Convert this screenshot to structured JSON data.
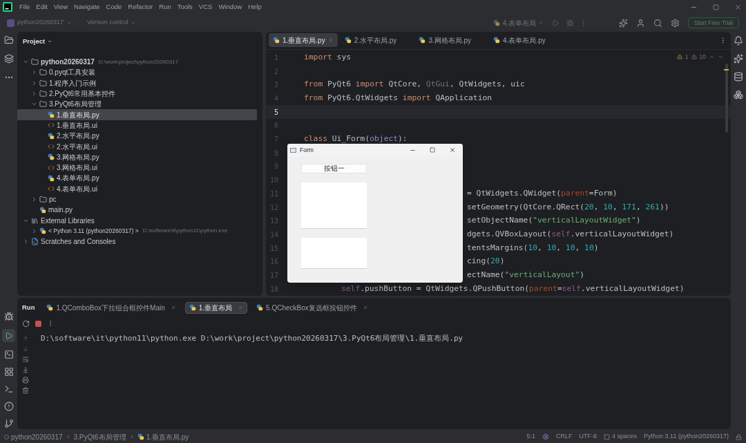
{
  "menu": [
    "File",
    "Edit",
    "View",
    "Navigate",
    "Code",
    "Refactor",
    "Run",
    "Tools",
    "VCS",
    "Window",
    "Help"
  ],
  "toolbar": {
    "project": "python20260317",
    "vcs": "Version control",
    "run_config": "4.表单布局",
    "trial_button": "Start Free Trial"
  },
  "project": {
    "title": "Project",
    "tree": [
      {
        "label": "python20260317",
        "kind": "folder",
        "expanded": true,
        "selected": false,
        "hint": "D:\\work\\project\\python20260317",
        "children": [
          {
            "label": "0.pyqt工具安装",
            "kind": "folder",
            "expanded": false,
            "selected": false
          },
          {
            "label": "1.程序入门示例",
            "kind": "folder",
            "expanded": false,
            "selected": false
          },
          {
            "label": "2.PyQt6常用基本控件",
            "kind": "folder",
            "expanded": false,
            "selected": false
          },
          {
            "label": "3.PyQt6布局管理",
            "kind": "folder",
            "expanded": true,
            "selected": false,
            "children": [
              {
                "label": "1.垂直布局.py",
                "kind": "py",
                "selected": true
              },
              {
                "label": "1.垂直布局.ui",
                "kind": "ui",
                "selected": false
              },
              {
                "label": "2.水平布局.py",
                "kind": "py",
                "selected": false
              },
              {
                "label": "2.水平布局.ui",
                "kind": "ui",
                "selected": false
              },
              {
                "label": "3.网格布局.py",
                "kind": "py",
                "selected": false
              },
              {
                "label": "3.网格布局.ui",
                "kind": "ui",
                "selected": false
              },
              {
                "label": "4.表单布局.py",
                "kind": "py",
                "selected": false
              },
              {
                "label": "4.表单布局.ui",
                "kind": "ui",
                "selected": false
              }
            ]
          },
          {
            "label": "pc",
            "kind": "folder",
            "expanded": false,
            "selected": false
          },
          {
            "label": "main.py",
            "kind": "py",
            "selected": false
          }
        ]
      },
      {
        "label": "External Libraries",
        "kind": "library",
        "expanded": true,
        "selected": false,
        "children": [
          {
            "label": "< Python 3.11 (python20260317) >",
            "kind": "sdk",
            "expanded": false,
            "selected": false,
            "hint": "D:\\software\\it\\python11\\python.exe"
          }
        ]
      },
      {
        "label": "Scratches and Consoles",
        "kind": "scratches",
        "expanded": false,
        "selected": false
      }
    ]
  },
  "editor": {
    "tabs": [
      {
        "label": "1.垂直布局.py",
        "selected": true
      },
      {
        "label": "2.水平布局.py",
        "selected": false
      },
      {
        "label": "3.网格布局.py",
        "selected": false
      },
      {
        "label": "4.表单布局.py",
        "selected": false
      }
    ],
    "warnings": "1",
    "weak_warnings": "10",
    "lines": [
      {
        "number": "1",
        "current": false,
        "covered": false,
        "indented": false,
        "tokens": [
          {
            "text": "import",
            "kind": "kw"
          },
          {
            "text": " sys",
            "kind": "plain"
          }
        ]
      },
      {
        "number": "2",
        "current": false
      },
      {
        "number": "3",
        "current": false,
        "covered": false,
        "indented": false,
        "tokens": [
          {
            "text": "from",
            "kind": "kw"
          },
          {
            "text": " PyQt6 ",
            "kind": "plain"
          },
          {
            "text": "import",
            "kind": "kw"
          },
          {
            "text": " QtCore, ",
            "kind": "plain"
          },
          {
            "text": "QtGui",
            "kind": "unused"
          },
          {
            "text": ", QtWidgets, uic",
            "kind": "plain"
          }
        ]
      },
      {
        "number": "4",
        "current": false,
        "covered": false,
        "indented": false,
        "tokens": [
          {
            "text": "from",
            "kind": "kw"
          },
          {
            "text": " PyQt6.QtWidgets ",
            "kind": "plain"
          },
          {
            "text": "import",
            "kind": "kw"
          },
          {
            "text": " QApplication",
            "kind": "plain"
          }
        ]
      },
      {
        "number": "5",
        "current": true
      },
      {
        "number": "6",
        "current": false
      },
      {
        "number": "7",
        "current": false,
        "covered": false,
        "indented": false,
        "tokens": [
          {
            "text": "class",
            "kind": "kw"
          },
          {
            "text": " Ui_Form(",
            "kind": "plain"
          },
          {
            "text": "object",
            "kind": "builtin"
          },
          {
            "text": "):",
            "kind": "plain"
          }
        ]
      },
      {
        "number": "8",
        "current": false
      },
      {
        "number": "9",
        "current": false
      },
      {
        "number": "10",
        "current": false
      },
      {
        "number": "11",
        "current": false,
        "covered": true,
        "indented": false,
        "tokens": [
          {
            "text": "= QtWidgets.QWidget(",
            "kind": "plain"
          },
          {
            "text": "parent",
            "kind": "param"
          },
          {
            "text": "=Form)",
            "kind": "plain"
          }
        ]
      },
      {
        "number": "12",
        "current": false,
        "covered": true,
        "indented": false,
        "tokens": [
          {
            "text": "setGeometry(QtCore.QRect(",
            "kind": "plain"
          },
          {
            "text": "20",
            "kind": "num"
          },
          {
            "text": ", ",
            "kind": "plain"
          },
          {
            "text": "10",
            "kind": "num"
          },
          {
            "text": ", ",
            "kind": "plain"
          },
          {
            "text": "171",
            "kind": "num"
          },
          {
            "text": ", ",
            "kind": "plain"
          },
          {
            "text": "261",
            "kind": "num"
          },
          {
            "text": "))",
            "kind": "plain"
          }
        ]
      },
      {
        "number": "13",
        "current": false,
        "covered": true,
        "indented": false,
        "tokens": [
          {
            "text": "setObjectName(",
            "kind": "plain"
          },
          {
            "text": "\"verticalLayoutWidget\"",
            "kind": "str"
          },
          {
            "text": ")",
            "kind": "plain"
          }
        ]
      },
      {
        "number": "14",
        "current": false,
        "covered": true,
        "indented": false,
        "tokens": [
          {
            "text": "dgets.QVBoxLayout(",
            "kind": "plain"
          },
          {
            "text": "self",
            "kind": "self"
          },
          {
            "text": ".verticalLayoutWidget)",
            "kind": "plain"
          }
        ]
      },
      {
        "number": "15",
        "current": false,
        "covered": true,
        "indented": false,
        "tokens": [
          {
            "text": "tentsMargins(",
            "kind": "plain"
          },
          {
            "text": "10",
            "kind": "num"
          },
          {
            "text": ", ",
            "kind": "plain"
          },
          {
            "text": "10",
            "kind": "num"
          },
          {
            "text": ", ",
            "kind": "plain"
          },
          {
            "text": "10",
            "kind": "num"
          },
          {
            "text": ", ",
            "kind": "plain"
          },
          {
            "text": "10",
            "kind": "num"
          },
          {
            "text": ")",
            "kind": "plain"
          }
        ]
      },
      {
        "number": "16",
        "current": false,
        "covered": true,
        "indented": false,
        "tokens": [
          {
            "text": "cing(",
            "kind": "plain"
          },
          {
            "text": "20",
            "kind": "num"
          },
          {
            "text": ")",
            "kind": "plain"
          }
        ]
      },
      {
        "number": "17",
        "current": false,
        "covered": true,
        "indented": false,
        "tokens": [
          {
            "text": "ectName(",
            "kind": "plain"
          },
          {
            "text": "\"verticalLayout\"",
            "kind": "str"
          },
          {
            "text": ")",
            "kind": "plain"
          }
        ]
      },
      {
        "number": "18",
        "current": false,
        "covered": false,
        "indented": true,
        "tokens": [
          {
            "text": "self",
            "kind": "self"
          },
          {
            "text": ".pushButton = QtWidgets.QPushButton(",
            "kind": "plain"
          },
          {
            "text": "parent",
            "kind": "param"
          },
          {
            "text": "=",
            "kind": "plain"
          },
          {
            "text": "self",
            "kind": "self"
          },
          {
            "text": ".verticalLayoutWidget)",
            "kind": "plain"
          }
        ]
      }
    ]
  },
  "form_window": {
    "title": "Form",
    "button": "按钮一"
  },
  "run": {
    "title": "Run",
    "tabs": [
      {
        "label": "1.QComboBox下拉组合框控件Main",
        "selected": false
      },
      {
        "label": "1.垂直布局",
        "selected": true
      },
      {
        "label": "5.QCheckBox复选框按钮控件",
        "selected": false
      }
    ],
    "output": "D:\\software\\it\\python11\\python.exe D:\\work\\project\\python20260317\\3.PyQt6布局管理\\1.垂直布局.py"
  },
  "status_bar": {
    "breadcrumbs": [
      "python20260317",
      "3.PyQt6布局管理",
      "1.垂直布局.py"
    ],
    "position": "5:1",
    "line_separator": "CRLF",
    "encoding": "UTF-8",
    "indent": "4 spaces",
    "interpreter": "Python 3.11 (python20260317)"
  }
}
